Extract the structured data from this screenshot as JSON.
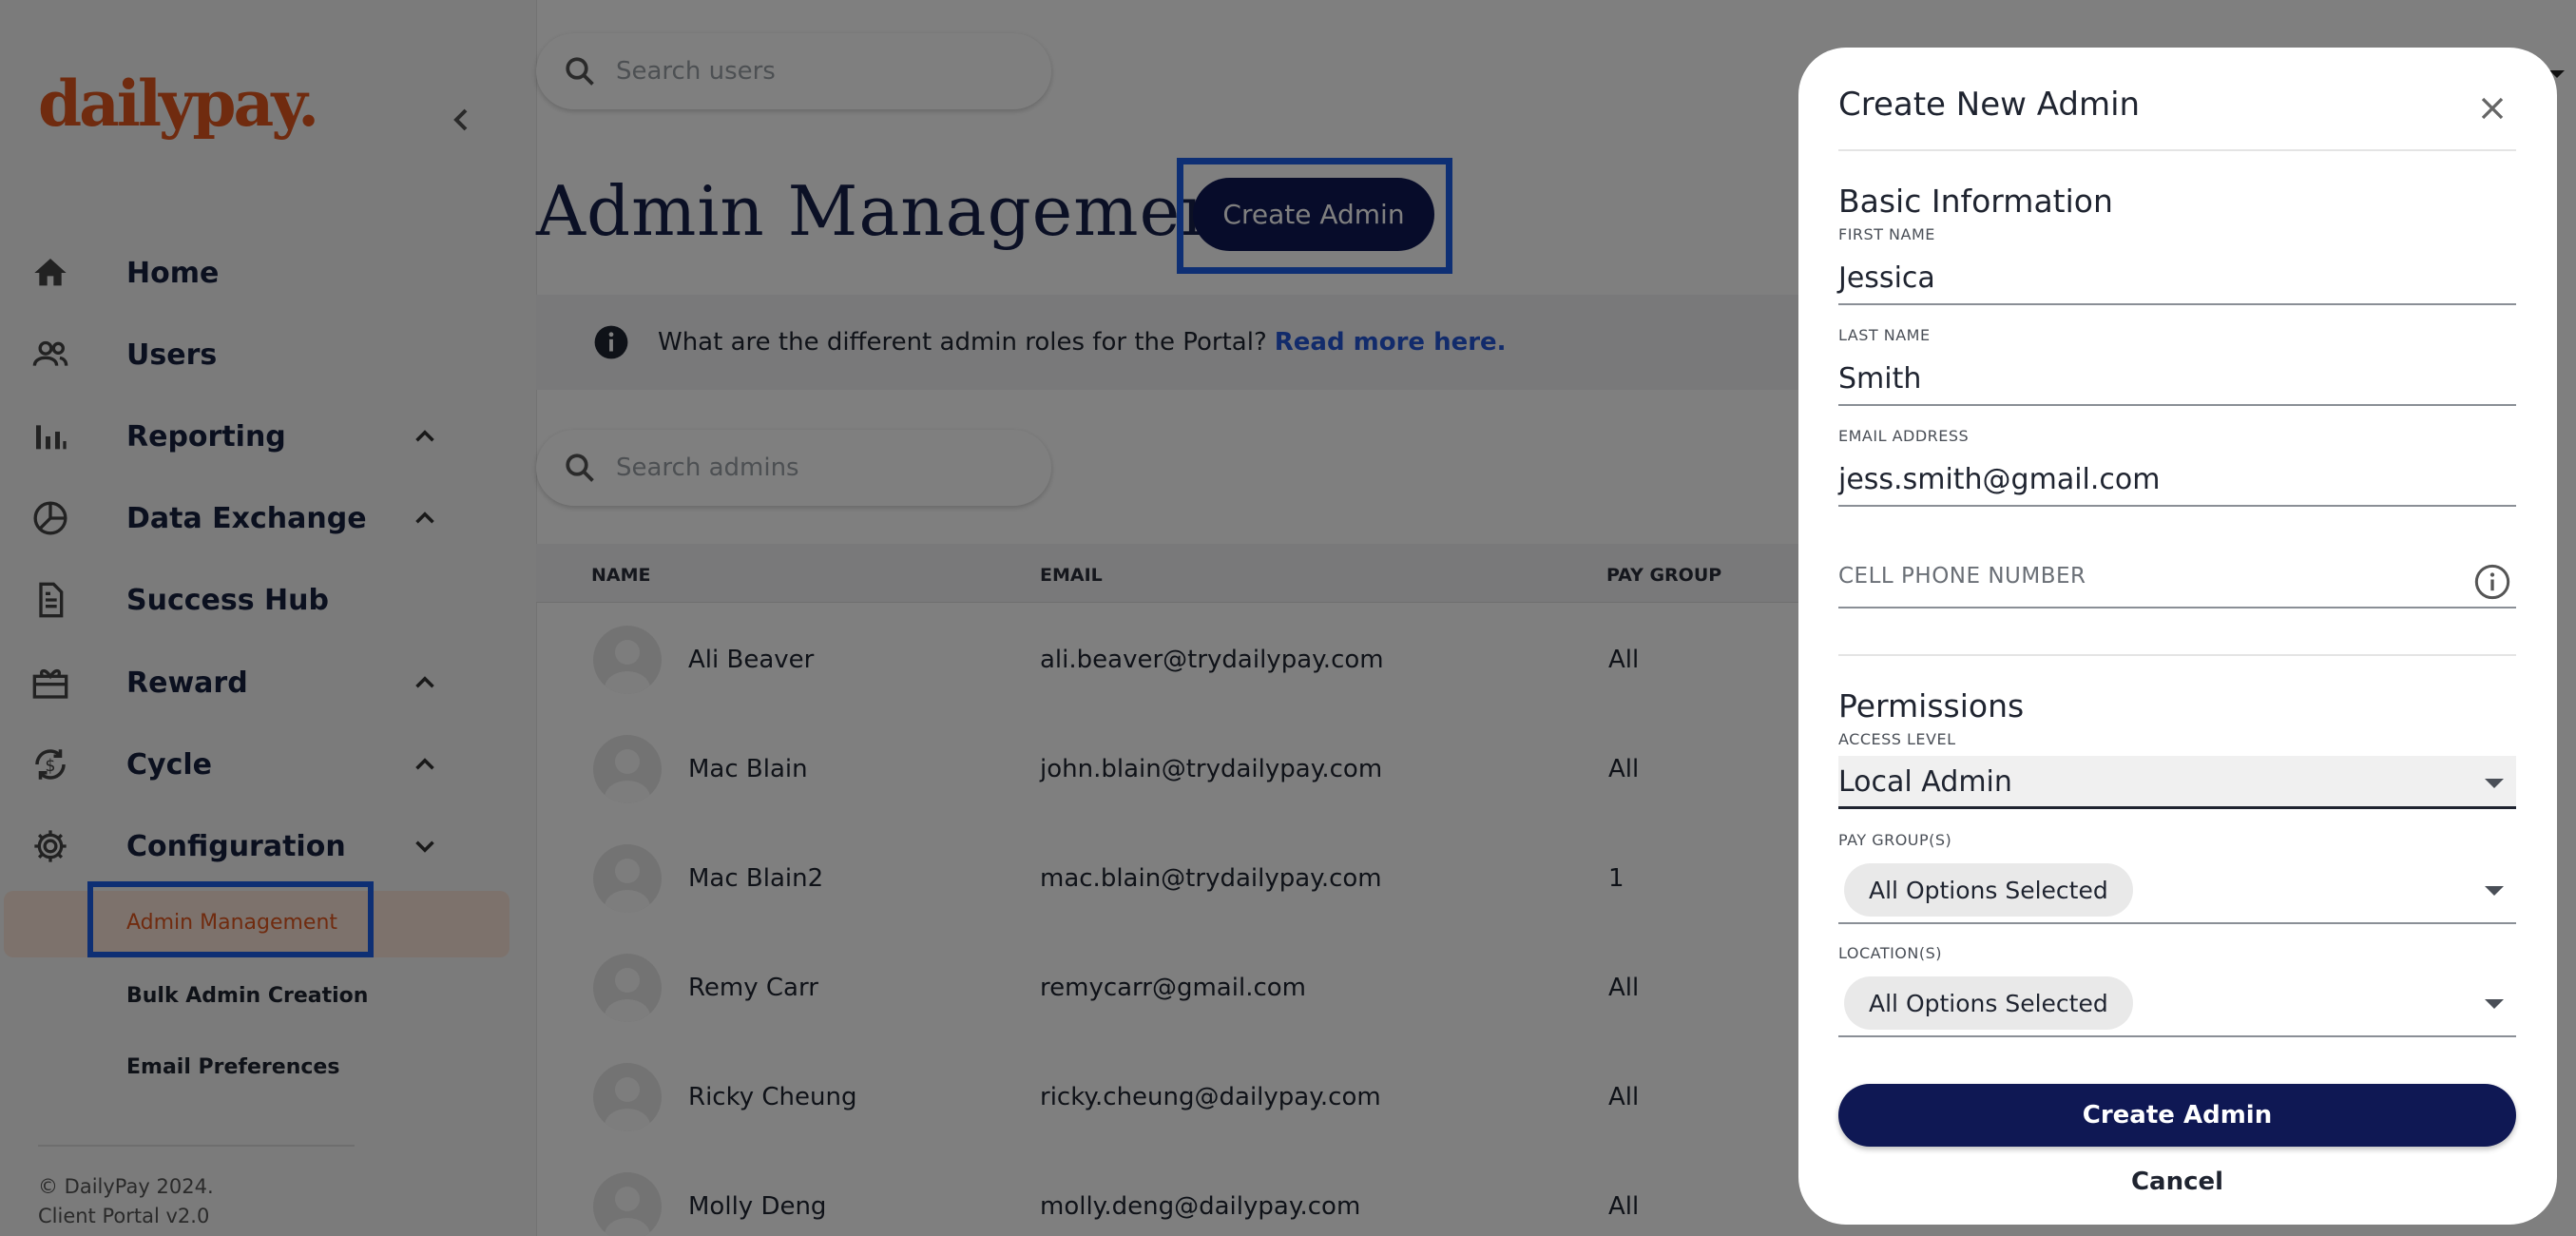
{
  "brand": {
    "logo_text": "dailypay.",
    "accent": "#e0561f",
    "navy": "#0f1854",
    "highlight": "#1d5fe8"
  },
  "header": {
    "search_placeholder": "Search users"
  },
  "sidebar": {
    "items": [
      {
        "label": "Home",
        "icon": "home-icon"
      },
      {
        "label": "Users",
        "icon": "users-icon"
      },
      {
        "label": "Reporting",
        "icon": "reporting-icon",
        "chevron": "up"
      },
      {
        "label": "Data Exchange",
        "icon": "data-exchange-icon",
        "chevron": "up"
      },
      {
        "label": "Success Hub",
        "icon": "document-icon"
      },
      {
        "label": "Reward",
        "icon": "gift-icon",
        "chevron": "up"
      },
      {
        "label": "Cycle",
        "icon": "cycle-icon",
        "chevron": "up"
      },
      {
        "label": "Configuration",
        "icon": "gear-icon",
        "chevron": "down"
      }
    ],
    "sub_items": [
      "Admin Management",
      "Bulk Admin Creation",
      "Email Preferences"
    ],
    "footer": {
      "copyright": "© DailyPay 2024.",
      "version": "Client Portal v2.0"
    }
  },
  "main": {
    "title": "Admin Management",
    "create_button": "Create Admin",
    "info": {
      "text": "What are the different admin roles for the Portal?",
      "link": "Read more here."
    },
    "admin_search_placeholder": "Search admins",
    "columns": [
      "NAME",
      "EMAIL",
      "PAY GROUP"
    ],
    "rows": [
      {
        "name": "Ali Beaver",
        "email": "ali.beaver@trydailypay.com",
        "pay_group": "All"
      },
      {
        "name": "Mac Blain",
        "email": "john.blain@trydailypay.com",
        "pay_group": "All"
      },
      {
        "name": "Mac Blain2",
        "email": "mac.blain@trydailypay.com",
        "pay_group": "1"
      },
      {
        "name": "Remy Carr",
        "email": "remycarr@gmail.com",
        "pay_group": "All"
      },
      {
        "name": "Ricky Cheung",
        "email": "ricky.cheung@dailypay.com",
        "pay_group": "All"
      },
      {
        "name": "Molly Deng",
        "email": "molly.deng@dailypay.com",
        "pay_group": "All"
      }
    ]
  },
  "modal": {
    "title": "Create New Admin",
    "basic_heading": "Basic Information",
    "first_name": {
      "label": "FIRST NAME",
      "value": "Jessica"
    },
    "last_name": {
      "label": "LAST NAME",
      "value": "Smith"
    },
    "email": {
      "label": "EMAIL ADDRESS",
      "value": "jess.smith@gmail.com"
    },
    "phone": {
      "placeholder": "CELL PHONE NUMBER"
    },
    "permissions_heading": "Permissions",
    "access_level": {
      "label": "ACCESS LEVEL",
      "value": "Local Admin"
    },
    "pay_groups": {
      "label": "PAY GROUP(S)",
      "chip": "All Options Selected"
    },
    "locations": {
      "label": "LOCATION(S)",
      "chip": "All Options Selected"
    },
    "submit": "Create Admin",
    "cancel": "Cancel"
  }
}
